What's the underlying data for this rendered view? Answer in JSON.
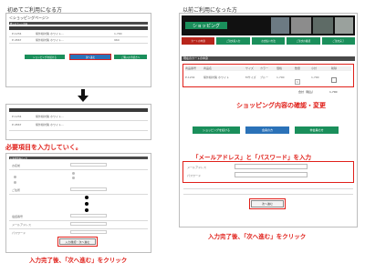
{
  "left": {
    "heading": "初めてご利用になる方",
    "page_title": "＜ショッピングページ＞",
    "table_head": "購入のカート内容",
    "row1_code": "P-1234",
    "row1_name": "紫外線対策 ホワイト...",
    "row1_price": "1,700",
    "row2_code": "P-4567",
    "row2_name": "紫外線対策 ホワイト...",
    "row2_price": "960",
    "btn_continue": "ショッピングを続ける",
    "btn_next": "次へ進む",
    "btn_other": "ご購入の手続きへ",
    "step_label": "必要項目を入力していく。",
    "form_head": "お客様情報の入力",
    "field_name": "お名前",
    "field_address": "ご住所",
    "field_tel": "電話番号",
    "field_email": "メールアドレス",
    "field_pw": "パスワード",
    "submit_btn": "入力確認・次へ進む",
    "instruction": "入力完了後、「次へ進む」をクリック"
  },
  "right": {
    "heading": "以前ご利用になった方",
    "banner": "ショッピング",
    "tabs": [
      "カートの中身",
      "ご注文者入力",
      "お支払い方法",
      "ご注文の確認",
      "ご注文完了"
    ],
    "cart_head": "現在のカートの中身",
    "cols": [
      "商品番号",
      "商品名",
      "サイズ",
      "カラー",
      "価格",
      "数量",
      "小計",
      "削除"
    ],
    "item_code": "P-1234",
    "item_name": "紫外線対策 ホワイト",
    "item_size": "Mサイズ",
    "item_color": "ブルー",
    "item_price": "1,700",
    "item_qty": "1",
    "item_subtotal": "1,700",
    "total_label": "合計（税込）",
    "total_value": "1,700",
    "confirm_label": "ショッピング内容の確認・変更",
    "btn_continue": "ショッピングを続ける",
    "btn_member": "会員の方",
    "btn_guest": "非会員の方",
    "login_label": "「メールアドレス」と「パスワード」を入力",
    "field_email": "メールアドレス",
    "field_pw": "パスワード",
    "submit_btn": "次へ進む",
    "instruction": "入力完了後、「次へ進む」をクリック"
  },
  "colors": {
    "accent_red": "#e0201a",
    "brand_green": "#1a8f5b",
    "dark_bar": "#3a3a3a"
  }
}
